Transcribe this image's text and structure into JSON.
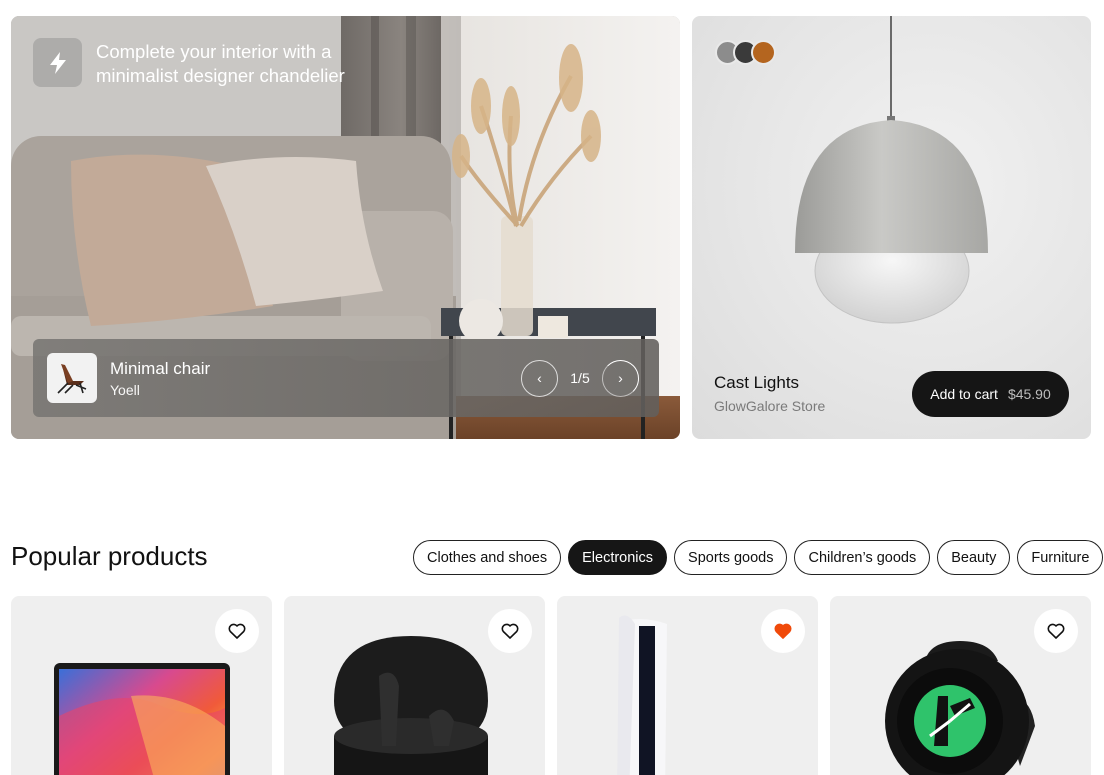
{
  "hero": {
    "title": "Complete your interior with a minimalist designer chandelier",
    "product_name": "Minimal chair",
    "product_brand": "Yoell",
    "pager": "1/5"
  },
  "feature": {
    "name": "Cast Lights",
    "store": "GlowGalore Store",
    "cart_label": "Add to cart",
    "price": "$45.90",
    "swatches": [
      "#8c8c8c",
      "#3a3a3a",
      "#b4651f"
    ]
  },
  "popular": {
    "title": "Popular products",
    "categories": [
      {
        "label": "Clothes and shoes",
        "active": false
      },
      {
        "label": "Electronics",
        "active": true
      },
      {
        "label": "Sports goods",
        "active": false
      },
      {
        "label": "Children’s goods",
        "active": false
      },
      {
        "label": "Beauty",
        "active": false
      },
      {
        "label": "Furniture",
        "active": false
      }
    ],
    "products": [
      {
        "icon": "laptop",
        "liked": false
      },
      {
        "icon": "earbuds",
        "liked": false
      },
      {
        "icon": "game-console",
        "liked": true
      },
      {
        "icon": "smartwatch",
        "liked": false
      }
    ]
  },
  "colors": {
    "accent_heart": "#f04a0a",
    "dark": "#151515"
  }
}
